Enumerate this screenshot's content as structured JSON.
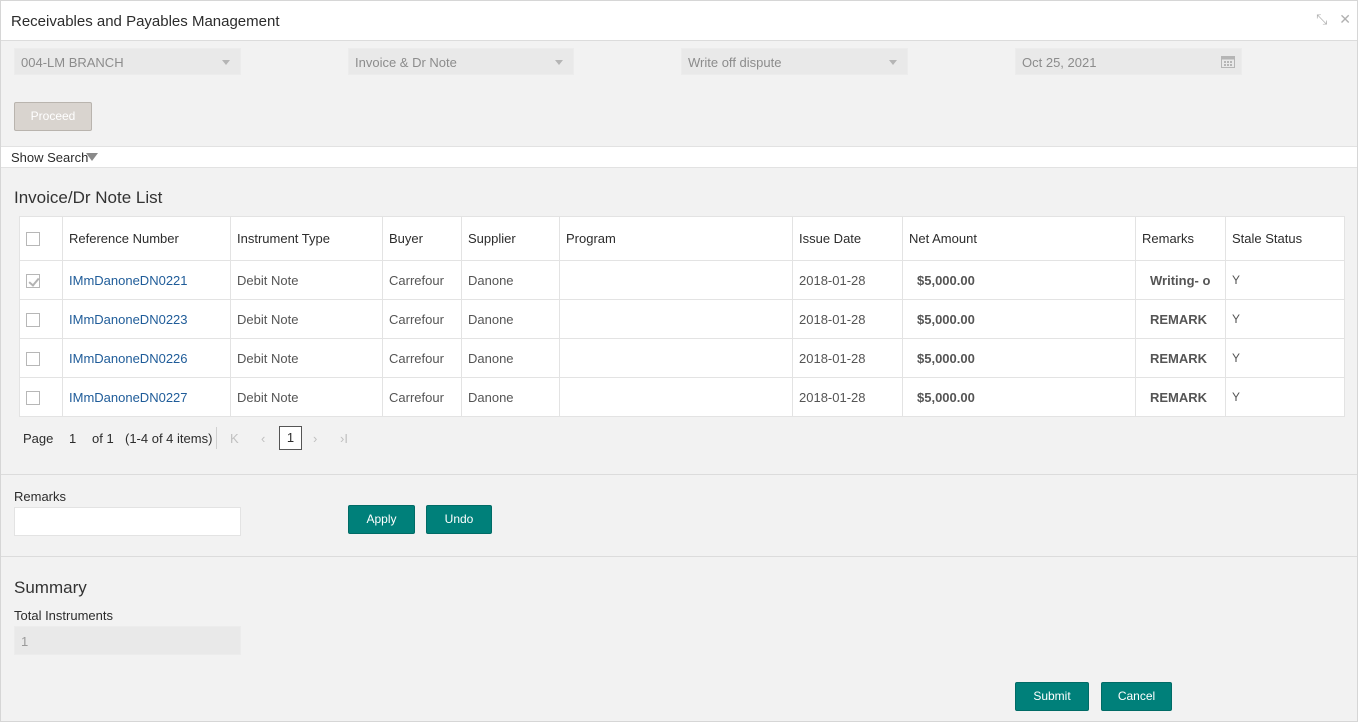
{
  "window": {
    "title": "Receivables and Payables Management",
    "restore_icon": "minimize-arrows-icon",
    "close_icon": "close-icon"
  },
  "filters": {
    "branch": "004-LM BRANCH",
    "instrument_type": "Invoice & Dr Note",
    "action": "Write off dispute",
    "date": "Oct 25, 2021"
  },
  "proceed_label": "Proceed",
  "show_search_label": "Show Search",
  "list": {
    "title": "Invoice/Dr Note List",
    "columns": [
      "Reference Number",
      "Instrument Type",
      "Buyer",
      "Supplier",
      "Program",
      "Issue Date",
      "Net Amount",
      "Remarks",
      "Stale Status"
    ],
    "rows": [
      {
        "checked": true,
        "ref": "IMmDanoneDN0221",
        "type": "Debit Note",
        "buyer": "Carrefour",
        "supplier": "Danone",
        "program": "",
        "issue_date": "2018-01-28",
        "net_amount": "$5,000.00",
        "remarks": "Writing- o",
        "stale": "Y"
      },
      {
        "checked": false,
        "ref": "IMmDanoneDN0223",
        "type": "Debit Note",
        "buyer": "Carrefour",
        "supplier": "Danone",
        "program": "",
        "issue_date": "2018-01-28",
        "net_amount": "$5,000.00",
        "remarks": "REMARK",
        "stale": "Y"
      },
      {
        "checked": false,
        "ref": "IMmDanoneDN0226",
        "type": "Debit Note",
        "buyer": "Carrefour",
        "supplier": "Danone",
        "program": "",
        "issue_date": "2018-01-28",
        "net_amount": "$5,000.00",
        "remarks": "REMARK",
        "stale": "Y"
      },
      {
        "checked": false,
        "ref": "IMmDanoneDN0227",
        "type": "Debit Note",
        "buyer": "Carrefour",
        "supplier": "Danone",
        "program": "",
        "issue_date": "2018-01-28",
        "net_amount": "$5,000.00",
        "remarks": "REMARK",
        "stale": "Y"
      }
    ]
  },
  "pager": {
    "page_label": "Page",
    "page_value": "1",
    "of_label": "of 1",
    "items_label": "(1-4 of 4 items)",
    "current": "1",
    "first": "K",
    "prev": "‹",
    "next": "›",
    "last": "›I"
  },
  "remarks": {
    "label": "Remarks",
    "value": "",
    "apply_label": "Apply",
    "undo_label": "Undo"
  },
  "summary": {
    "title": "Summary",
    "total_label": "Total Instruments",
    "total_value": "1"
  },
  "footer": {
    "submit_label": "Submit",
    "cancel_label": "Cancel"
  }
}
